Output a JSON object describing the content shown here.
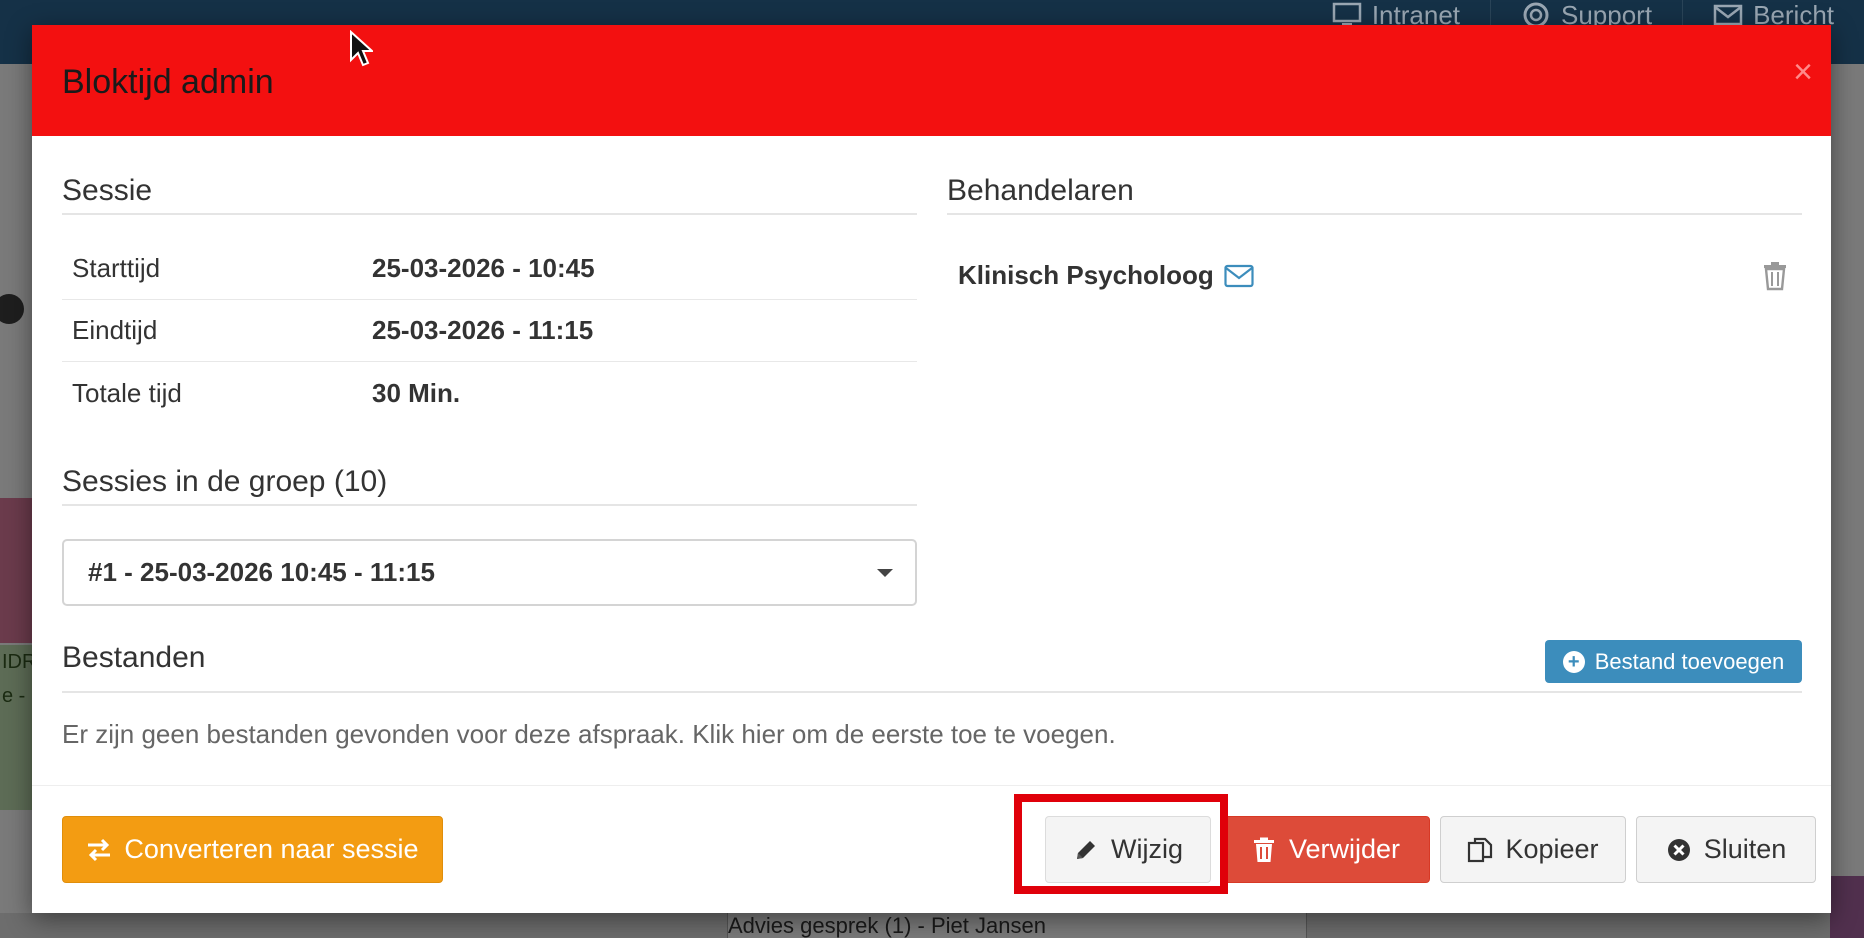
{
  "background": {
    "topnav": [
      {
        "label": "Intranet",
        "icon": "monitor-icon"
      },
      {
        "label": "Support",
        "icon": "lifebuoy-icon"
      },
      {
        "label": "Bericht",
        "icon": "envelope-icon"
      }
    ],
    "bottom_text": "Advies gesprek (1) - Piet Jansen",
    "left_green_lines": [
      "IDR",
      "e -"
    ]
  },
  "modal": {
    "title": "Bloktijd admin",
    "close_glyph": "×",
    "session": {
      "title": "Sessie",
      "rows": [
        {
          "label": "Starttijd",
          "value": "25-03-2026 - 10:45"
        },
        {
          "label": "Eindtijd",
          "value": "25-03-2026 - 11:15"
        },
        {
          "label": "Totale tijd",
          "value": "30 Min."
        }
      ]
    },
    "group": {
      "title": "Sessies in de groep (10)",
      "selected": "#1 - 25-03-2026 10:45 - 11:15"
    },
    "therapists": {
      "title": "Behandelaren",
      "items": [
        {
          "name": "Klinisch Psycholoog"
        }
      ]
    },
    "files": {
      "title": "Bestanden",
      "add_label": "Bestand toevoegen",
      "empty_text": "Er zijn geen bestanden gevonden voor deze afspraak. Klik hier om de eerste toe te voegen."
    },
    "footer": {
      "convert_label": "Converteren naar sessie",
      "edit_label": "Wijzig",
      "delete_label": "Verwijder",
      "copy_label": "Kopieer",
      "close_label": "Sluiten"
    }
  },
  "colors": {
    "header": "#f31010",
    "primary": "#3c8dbc",
    "warning": "#f39c12",
    "danger": "#dd4b39",
    "highlight": "#e0000a"
  }
}
